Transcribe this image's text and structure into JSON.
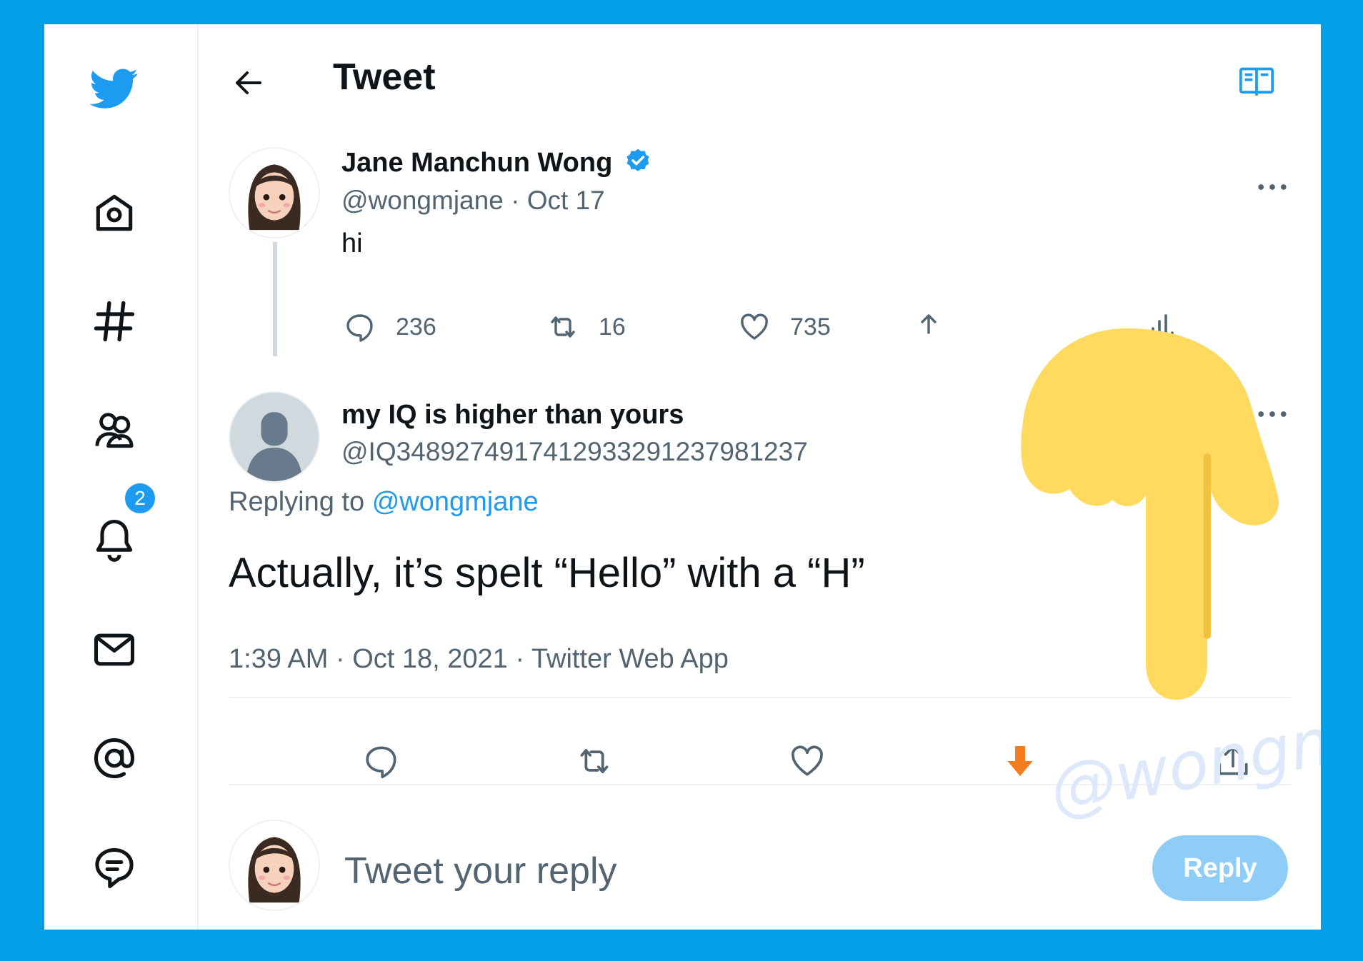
{
  "page": {
    "title": "Tweet"
  },
  "sidebar": {
    "items": [
      {
        "name": "bird-logo-icon"
      },
      {
        "name": "home-icon"
      },
      {
        "name": "explore-hashtag-icon"
      },
      {
        "name": "communities-icon"
      },
      {
        "name": "notifications-bell-icon",
        "badge": "2"
      },
      {
        "name": "messages-mail-icon"
      },
      {
        "name": "mentions-at-icon"
      },
      {
        "name": "topics-chat-icon"
      }
    ]
  },
  "original_tweet": {
    "author_name": "Jane Manchun Wong",
    "verified": true,
    "handle": "@wongmjane",
    "date": "Oct 17",
    "text": "hi",
    "replies": "236",
    "retweets": "16",
    "likes": "735"
  },
  "reply_tweet": {
    "author_name": "my IQ is higher than yours",
    "handle": "@IQ3489274917412933291237981237",
    "replying_label": "Replying to",
    "replying_to": "@wongmjane",
    "text": "Actually, it’s spelt “Hello” with a “H”",
    "time": "1:39 AM",
    "date": "Oct 18, 2021",
    "source": "Twitter Web App"
  },
  "composer": {
    "placeholder": "Tweet your reply",
    "button_label": "Reply"
  },
  "watermark": "@wongmjane",
  "colors": {
    "background": "#03a0e8",
    "accent": "#1d9bf0",
    "secondary_text": "#536471",
    "hand": "#ffda5f",
    "down_arrow": "#f47c1c"
  }
}
